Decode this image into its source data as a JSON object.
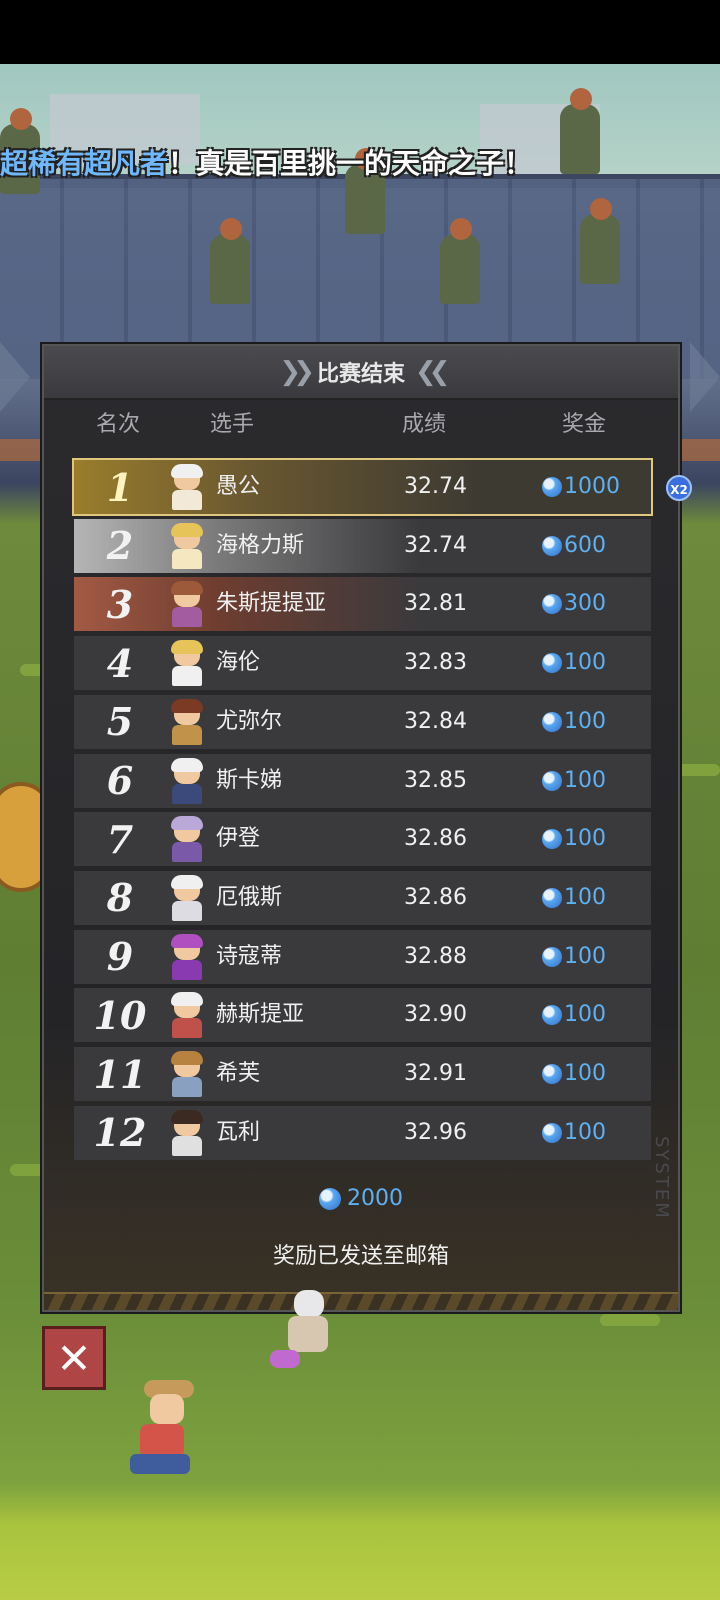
{
  "banner": {
    "highlight": "超稀有超凡者",
    "text": "！真是百里挑一的天命之子！"
  },
  "panel": {
    "title": "比赛结束",
    "columns": {
      "rank": "名次",
      "player": "选手",
      "score": "成绩",
      "prize": "奖金"
    }
  },
  "rows": [
    {
      "rank": "1",
      "name": "愚公",
      "score": "32.74",
      "prize": "1000",
      "badge": "X2"
    },
    {
      "rank": "2",
      "name": "海格力斯",
      "score": "32.74",
      "prize": "600"
    },
    {
      "rank": "3",
      "name": "朱斯提提亚",
      "score": "32.81",
      "prize": "300"
    },
    {
      "rank": "4",
      "name": "海伦",
      "score": "32.83",
      "prize": "100"
    },
    {
      "rank": "5",
      "name": "尤弥尔",
      "score": "32.84",
      "prize": "100"
    },
    {
      "rank": "6",
      "name": "斯卡娣",
      "score": "32.85",
      "prize": "100"
    },
    {
      "rank": "7",
      "name": "伊登",
      "score": "32.86",
      "prize": "100"
    },
    {
      "rank": "8",
      "name": "厄俄斯",
      "score": "32.86",
      "prize": "100"
    },
    {
      "rank": "9",
      "name": "诗寇蒂",
      "score": "32.88",
      "prize": "100"
    },
    {
      "rank": "10",
      "name": "赫斯提亚",
      "score": "32.90",
      "prize": "100"
    },
    {
      "rank": "11",
      "name": "希芙",
      "score": "32.91",
      "prize": "100"
    },
    {
      "rank": "12",
      "name": "瓦利",
      "score": "32.96",
      "prize": "100"
    }
  ],
  "total": {
    "value": "2000",
    "note": "奖励已发送至邮箱"
  },
  "watermark": "SYSTEM",
  "close": {
    "label": "✕"
  },
  "colors": {
    "gem": "#5fb0f2",
    "gold": "#9a7d2c",
    "silver": "#b5b5b5",
    "bronze": "#a35a44",
    "close": "#b04545"
  }
}
